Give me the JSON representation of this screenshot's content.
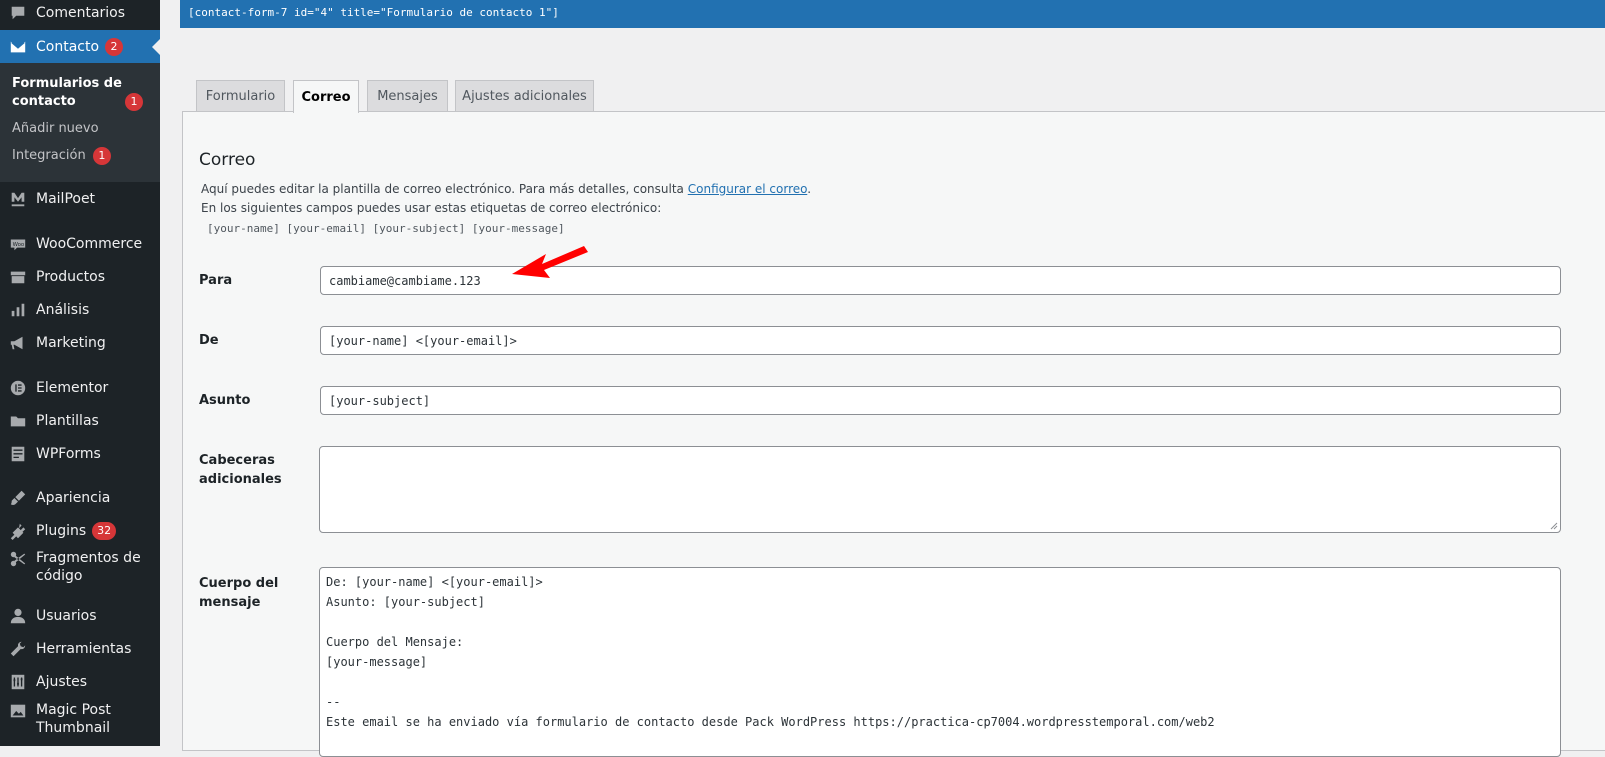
{
  "sidebar": {
    "items": [
      {
        "label": "Comentarios",
        "icon": "comment-icon"
      },
      {
        "label": "Contacto",
        "icon": "mail-icon",
        "badge": "2",
        "active": true
      },
      {
        "label": "MailPoet",
        "icon": "mailpoet-icon"
      },
      {
        "label": "WooCommerce",
        "icon": "woo-icon"
      },
      {
        "label": "Productos",
        "icon": "archive-icon"
      },
      {
        "label": "Análisis",
        "icon": "bar-chart-icon"
      },
      {
        "label": "Marketing",
        "icon": "megaphone-icon"
      },
      {
        "label": "Elementor",
        "icon": "elementor-icon"
      },
      {
        "label": "Plantillas",
        "icon": "folder-icon"
      },
      {
        "label": "WPForms",
        "icon": "form-icon"
      },
      {
        "label": "Apariencia",
        "icon": "paintbrush-icon"
      },
      {
        "label": "Plugins",
        "icon": "plugin-icon",
        "badge": "32"
      },
      {
        "label": "Fragmentos de código",
        "icon": "scissors-icon"
      },
      {
        "label": "Usuarios",
        "icon": "user-icon"
      },
      {
        "label": "Herramientas",
        "icon": "wrench-icon"
      },
      {
        "label": "Ajustes",
        "icon": "settings-icon"
      },
      {
        "label": "Magic Post Thumbnail",
        "icon": "image-icon"
      }
    ],
    "submenu": [
      {
        "label": "Formularios de contacto",
        "badge": "1",
        "current": true
      },
      {
        "label": "Añadir nuevo"
      },
      {
        "label": "Integración",
        "badge": "1"
      }
    ]
  },
  "shortcode": "[contact-form-7 id=\"4\" title=\"Formulario de contacto 1\"]",
  "tabs": [
    "Formulario",
    "Correo",
    "Mensajes",
    "Ajustes adicionales"
  ],
  "active_tab": "Correo",
  "panel": {
    "title": "Correo",
    "help_text": "Aquí puedes editar la plantilla de correo electrónico. Para más detalles, consulta",
    "help_link": "Configurar el correo",
    "help_suffix": ".",
    "tags_intro": "En los siguientes campos puedes usar estas etiquetas de correo electrónico:",
    "tags": "[your-name] [your-email] [your-subject] [your-message]"
  },
  "fields": {
    "to": {
      "label": "Para",
      "value": "cambiame@cambiame.123"
    },
    "from": {
      "label": "De",
      "value": "[your-name] <[your-email]>"
    },
    "subject": {
      "label": "Asunto",
      "value": "[your-subject]"
    },
    "headers": {
      "label_1": "Cabeceras",
      "label_2": "adicionales",
      "value": ""
    },
    "body": {
      "label_1": "Cuerpo del",
      "label_2": "mensaje",
      "lines": [
        "De: [your-name] <[your-email]>",
        "Asunto: [your-subject]",
        "",
        "Cuerpo del Mensaje:",
        "[your-message]",
        "",
        "--",
        "Este email se ha enviado vía formulario de contacto desde Pack WordPress https://practica-cp7004.wordpresstemporal.com/web2"
      ]
    }
  },
  "annotation": {
    "arrow_color": "#ff0000"
  },
  "colors": {
    "sidebar_bg": "#1d2327",
    "accent": "#2271b1",
    "badge": "#d63638"
  }
}
